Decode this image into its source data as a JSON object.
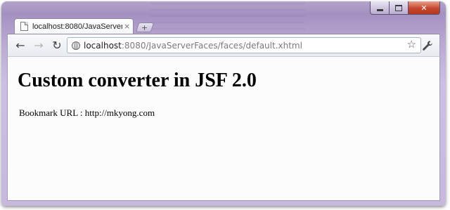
{
  "browser": {
    "tab": {
      "title": "localhost:8080/JavaServer...",
      "close_glyph": "×",
      "icon": "page-icon"
    },
    "new_tab_glyph": "+",
    "nav": {
      "back_glyph": "←",
      "forward_glyph": "→",
      "reload_glyph": "↻"
    },
    "address": {
      "host": "localhost",
      "rest": ":8080/JavaServerFaces/faces/default.xhtml"
    },
    "star_glyph": "☆",
    "wrench_glyph": "🔧",
    "caption": {
      "close_glyph": "✕"
    }
  },
  "page": {
    "heading": "Custom converter in JSF 2.0",
    "bookmark_line": "Bookmark URL : http://mkyong.com"
  },
  "colors": {
    "frame": "#c7b8de",
    "close_button": "#c6452c"
  }
}
